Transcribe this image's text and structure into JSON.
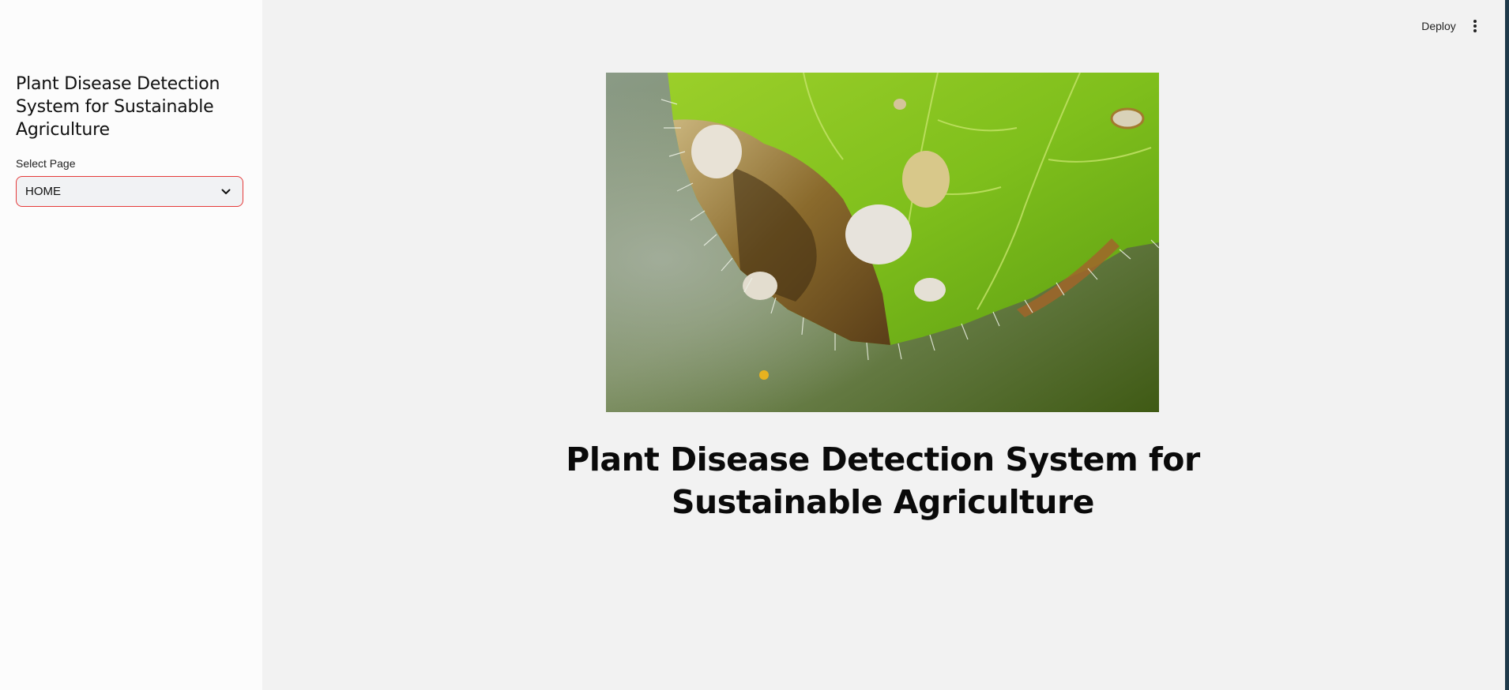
{
  "sidebar": {
    "title": "Plant Disease Detection System for Sustainable Agriculture",
    "select_label": "Select Page",
    "select_value": "HOME"
  },
  "header": {
    "deploy_label": "Deploy",
    "menu_icon": "more-vertical-icon"
  },
  "main": {
    "image_subject": "diseased-leaf-photo",
    "title": "Plant Disease Detection System for Sustainable Agriculture"
  },
  "colors": {
    "select_border": "#e53a3a",
    "background": "#f2f2f2",
    "sidebar": "#fcfcfc"
  }
}
